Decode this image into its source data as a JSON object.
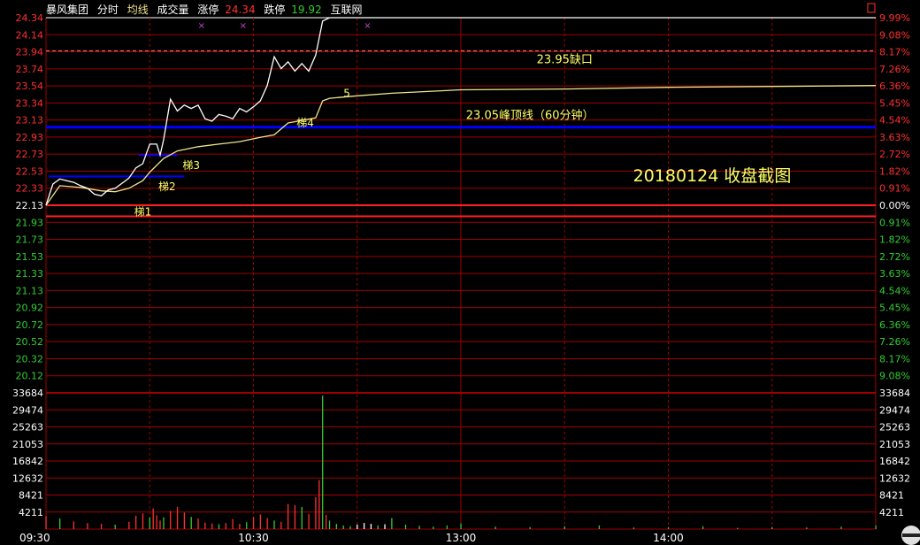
{
  "header": {
    "stock_name": "暴风集团",
    "mode": "分时",
    "avg_label": "均线",
    "volume_label": "成交量",
    "limit_up_label": "涨停",
    "limit_up_value": "24.34",
    "limit_down_label": "跌停",
    "limit_down_value": "19.92",
    "source": "互联网"
  },
  "colors": {
    "background": "#000000",
    "grid": "#a00000",
    "price_line": "#ffffff",
    "avg_line": "#f0e68c",
    "up_text": "#ff3030",
    "down_text": "#33cc33",
    "annotation": "#ffff66",
    "blue_line": "#0000ff"
  },
  "chart_data": {
    "type": "line",
    "prev_close": 22.13,
    "price_ticks": [
      "24.34",
      "24.14",
      "23.94",
      "23.74",
      "23.54",
      "23.34",
      "23.13",
      "22.93",
      "22.73",
      "22.53",
      "22.33",
      "22.13",
      "21.93",
      "21.73",
      "21.53",
      "21.33",
      "21.13",
      "20.92",
      "20.72",
      "20.52",
      "20.32",
      "20.12"
    ],
    "pct_ticks": [
      "9.99%",
      "9.08%",
      "8.17%",
      "7.26%",
      "6.36%",
      "5.45%",
      "4.54%",
      "3.63%",
      "2.72%",
      "1.82%",
      "0.91%",
      "0.00%",
      "0.91%",
      "1.82%",
      "2.72%",
      "3.63%",
      "4.54%",
      "5.45%",
      "6.36%",
      "7.26%",
      "8.17%",
      "9.08%"
    ],
    "volume_ticks": [
      "33684",
      "29474",
      "25263",
      "21053",
      "16842",
      "12632",
      "8421",
      "4211"
    ],
    "time_labels": [
      "09:30",
      "10:30",
      "13:00",
      "14:00"
    ],
    "ylim": [
      19.92,
      24.34
    ],
    "volume_max": 33684,
    "price": {
      "t": [
        0,
        2,
        4,
        6,
        8,
        10,
        12,
        14,
        16,
        18,
        20,
        22,
        24,
        26,
        28,
        30,
        32,
        33,
        34,
        36,
        38,
        40,
        42,
        44,
        46,
        48,
        50,
        52,
        54,
        56,
        58,
        60,
        62,
        64,
        66,
        68,
        70,
        72,
        74,
        76,
        78,
        80,
        82,
        84,
        86,
        88,
        89,
        90,
        91,
        92,
        94,
        240
      ],
      "v": [
        22.13,
        22.38,
        22.44,
        22.42,
        22.4,
        22.36,
        22.33,
        22.26,
        22.24,
        22.31,
        22.33,
        22.39,
        22.45,
        22.57,
        22.62,
        22.85,
        22.85,
        22.72,
        22.9,
        23.38,
        23.24,
        23.31,
        23.27,
        23.31,
        23.15,
        23.12,
        23.2,
        23.18,
        23.15,
        23.27,
        23.23,
        23.29,
        23.36,
        23.54,
        23.88,
        23.74,
        23.82,
        23.71,
        23.8,
        23.71,
        23.9,
        24.3,
        24.34,
        24.34,
        24.34,
        24.34,
        24.34,
        24.34,
        24.34,
        24.34,
        24.34,
        24.34
      ]
    },
    "avg": {
      "t": [
        0,
        4,
        10,
        16,
        20,
        24,
        28,
        30,
        34,
        38,
        44,
        50,
        56,
        62,
        66,
        70,
        74,
        78,
        80,
        82,
        90,
        100,
        120,
        150,
        180,
        210,
        240
      ],
      "v": [
        22.13,
        22.36,
        22.34,
        22.3,
        22.29,
        22.33,
        22.42,
        22.52,
        22.68,
        22.77,
        22.82,
        22.85,
        22.88,
        22.93,
        22.96,
        23.1,
        23.13,
        23.16,
        23.36,
        23.39,
        23.42,
        23.45,
        23.49,
        23.5,
        23.52,
        23.53,
        23.54
      ]
    },
    "volume": {
      "t": [
        0,
        4,
        8,
        12,
        16,
        20,
        24,
        26,
        28,
        30,
        31,
        32,
        33,
        34,
        36,
        38,
        40,
        42,
        44,
        46,
        48,
        50,
        52,
        54,
        56,
        58,
        60,
        62,
        64,
        66,
        68,
        70,
        72,
        74,
        76,
        78,
        79,
        80,
        81,
        82,
        84,
        86,
        88,
        90,
        92,
        94,
        96,
        98,
        100,
        104,
        108,
        112,
        116,
        120,
        130,
        140,
        150,
        160,
        170,
        180,
        190,
        200,
        210,
        220,
        230,
        240
      ],
      "v": [
        3200,
        2600,
        1900,
        1500,
        1300,
        1100,
        1800,
        3300,
        3900,
        2900,
        5100,
        3400,
        2100,
        2900,
        4500,
        5500,
        4100,
        3000,
        2600,
        1600,
        1400,
        1200,
        1500,
        2500,
        1300,
        1700,
        3000,
        3600,
        2700,
        2100,
        1800,
        6200,
        5900,
        5500,
        3700,
        7900,
        12100,
        33000,
        3500,
        2100,
        1300,
        900,
        700,
        1100,
        1500,
        1300,
        900,
        1200,
        2700,
        1100,
        800,
        600,
        900,
        1400,
        600,
        500,
        700,
        900,
        400,
        500,
        700,
        300,
        500,
        400,
        600,
        900
      ]
    },
    "blue_lines": [
      {
        "label": "23.05峰顶线（60分钟）",
        "value": 23.05
      }
    ],
    "red_lines": [
      {
        "value": 22.13
      },
      {
        "value": 22.0
      }
    ],
    "gap_line": {
      "label": "23.95缺口",
      "value": 23.95
    },
    "ladders": [
      {
        "label": "梯1",
        "value": 22.2,
        "t_start": 0,
        "t_end": 0
      },
      {
        "label": "梯2",
        "value": 22.47,
        "t_start": 0,
        "t_end": 40
      },
      {
        "label": "梯3",
        "value": 22.72,
        "t_start": 26,
        "t_end": 38
      },
      {
        "label": "梯4",
        "value": 23.08,
        "t_start": 0,
        "t_end": 0
      },
      {
        "label": "5",
        "value": 23.55,
        "t_start": 0,
        "t_end": 0
      }
    ],
    "markers": [
      {
        "t": 45
      },
      {
        "t": 57
      },
      {
        "t": 93
      }
    ],
    "annotation": "20180124 收盘截图"
  }
}
